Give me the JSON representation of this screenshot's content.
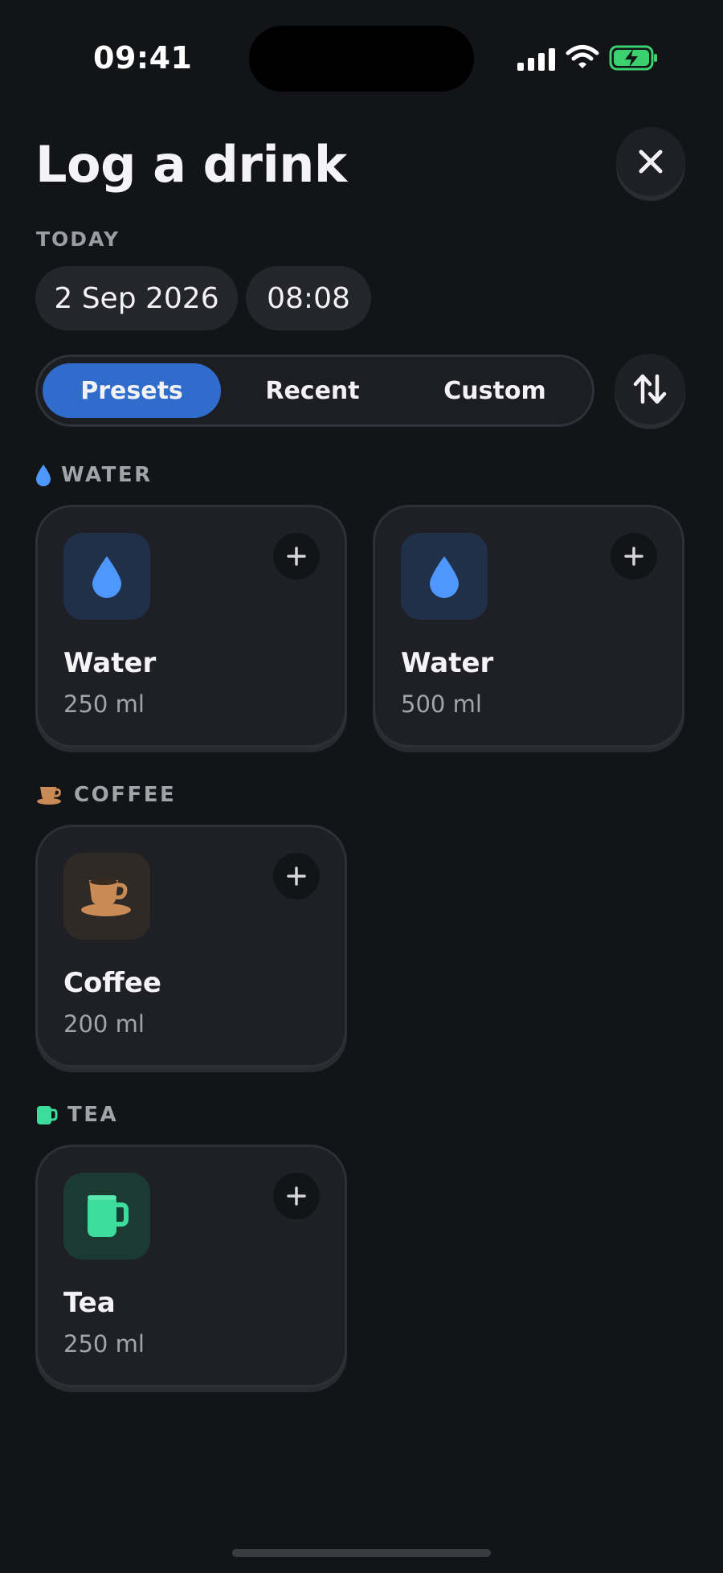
{
  "status_bar": {
    "time": "09:41"
  },
  "header": {
    "title": "Log a drink",
    "close_icon": "close-icon"
  },
  "date": {
    "label": "TODAY",
    "date_value": "2 Sep 2026",
    "time_value": "08:08"
  },
  "tabs": [
    {
      "label": "Presets",
      "active": true
    },
    {
      "label": "Recent",
      "active": false
    },
    {
      "label": "Custom",
      "active": false
    }
  ],
  "sort_icon": "sort-icon",
  "sections": [
    {
      "title": "WATER",
      "icon": "water-drop-icon",
      "color": "#4d97ff",
      "items": [
        {
          "name": "Water",
          "volume": "250 ml"
        },
        {
          "name": "Water",
          "volume": "500 ml"
        }
      ]
    },
    {
      "title": "COFFEE",
      "icon": "coffee-cup-icon",
      "color": "#c98a55",
      "items": [
        {
          "name": "Coffee",
          "volume": "200 ml"
        }
      ]
    },
    {
      "title": "TEA",
      "icon": "tea-mug-icon",
      "color": "#3ddc9d",
      "items": [
        {
          "name": "Tea",
          "volume": "250 ml"
        }
      ]
    }
  ],
  "colors": {
    "background": "#131418",
    "card": "#1f2025",
    "accent": "#2f6ccb",
    "water_tile": "#213049",
    "coffee_tile": "#2f2a26",
    "tea_tile": "#1a3a32"
  }
}
